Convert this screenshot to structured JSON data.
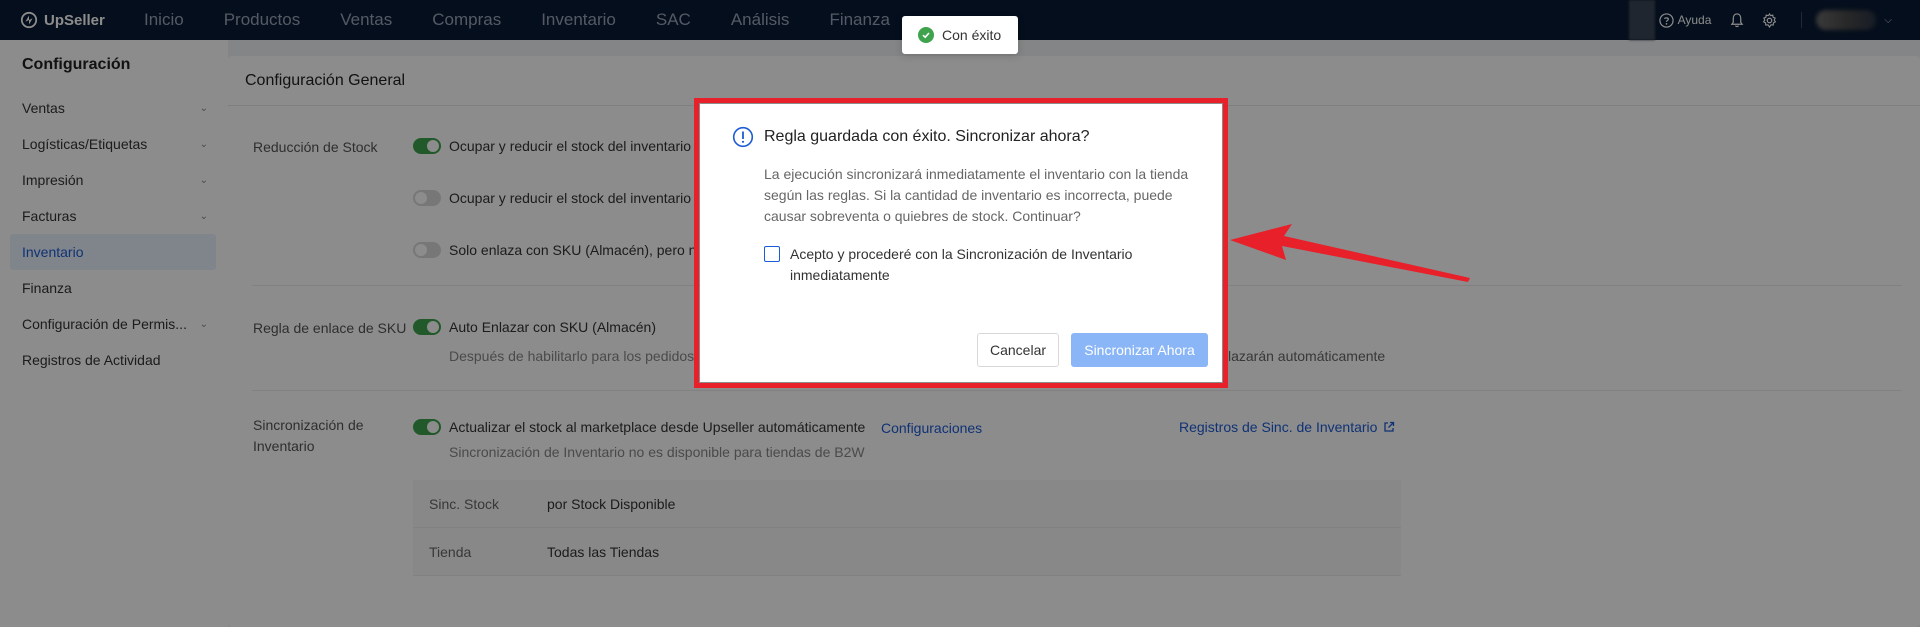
{
  "app": {
    "name": "UpSeller"
  },
  "nav": [
    "Inicio",
    "Productos",
    "Ventas",
    "Compras",
    "Inventario",
    "SAC",
    "Análisis",
    "Finanza"
  ],
  "topbar": {
    "help_label": "Ayuda"
  },
  "toast": {
    "text": "Con éxito"
  },
  "sidebar": {
    "title": "Configuración",
    "items": [
      {
        "label": "Ventas",
        "expandable": true
      },
      {
        "label": "Logísticas/Etiquetas",
        "expandable": true
      },
      {
        "label": "Impresión",
        "expandable": true
      },
      {
        "label": "Facturas",
        "expandable": true
      },
      {
        "label": "Inventario",
        "active": true
      },
      {
        "label": "Finanza"
      },
      {
        "label": "Configuración de Permis...",
        "expandable": true
      },
      {
        "label": "Registros de Actividad"
      }
    ]
  },
  "main": {
    "header": "Configuración General",
    "stock_reduction": {
      "label": "Reducción de Stock",
      "options": [
        {
          "text": "Ocupar y reducir el stock del inventario",
          "on": true
        },
        {
          "text": "Ocupar y reducir el stock del inventario",
          "on": false
        },
        {
          "text": "Solo enlaza con SKU (Almacén), pero n",
          "on": false
        }
      ]
    },
    "sku_link": {
      "label": "Regla de enlace de SKU",
      "option": "Auto Enlazar con SKU (Almacén)",
      "hint_left": "Después de habilitarlo para los pedidos",
      "hint_right": "lazarán automáticamente"
    },
    "inventory_sync": {
      "label_line1": "Sincronización de",
      "label_line2": "Inventario",
      "option": "Actualizar el stock al marketplace desde Upseller automáticamente",
      "config_link": "Configuraciones",
      "logs_link": "Registros de Sinc. de Inventario",
      "hint": "Sincronización de Inventario no es disponible para tiendas de B2W",
      "table": [
        {
          "key": "Sinc. Stock",
          "value": "por Stock Disponible"
        },
        {
          "key": "Tienda",
          "value": "Todas las Tiendas"
        }
      ]
    }
  },
  "modal": {
    "title": "Regla guardada con éxito. Sincronizar ahora?",
    "body": "La ejecución sincronizará inmediatamente el inventario con la tienda según las reglas. Si la cantidad de inventario es incorrecta, puede causar sobreventa o quiebres de stock. Continuar?",
    "checkbox_label": "Acepto y procederé con la Sincronización de Inventario inmediatamente",
    "checkbox_checked": false,
    "cancel_label": "Cancelar",
    "confirm_label": "Sincronizar Ahora"
  },
  "colors": {
    "topbar": "#081a33",
    "accent": "#1d5bd6",
    "success": "#3fa34d",
    "highlight": "#e8202a"
  }
}
